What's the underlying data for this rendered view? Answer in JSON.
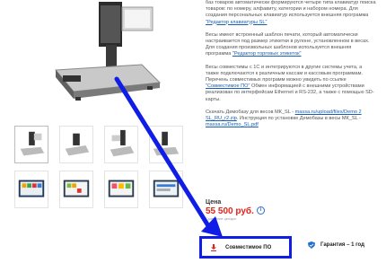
{
  "description": {
    "p1": "баз товаров автоматически формируются четыре типа клавиатур поиска товаров: по номеру, алфавиту, категории и набором номера. Для создания персональных клавиатур используется внешняя программа",
    "p1_link": "\"Редактор клавиатуры SL\"",
    "p2": "Весы имеют встроенный шаблон печати, который автоматически настраивается под размер этикетки в рулоне, установленном в весах. Для создания произвольных шаблонов используется внешняя программа",
    "p2_link": "\"Редактор торговых этикеток\"",
    "p3": "Весы совместимы с 1С и интегрируются в другие системы учета, а также подключаются к различным кассам и кассовым программам. Перечень совместимых программ можно увидеть по ссылке",
    "p3_link": "\"Совместимое ПО\"",
    "p3_tail": "Обмен информацией с внешними устройствами реализован по интерфейсам Ethernet и RS-232, а также с помощью SD-карты.",
    "p4": "Скачать Демобазу для весов МК_SL -",
    "p4_link": "massa.ru/upload/files/Demo 2 SL_RU_r2.zip",
    "p4_mid": ". Инструкция по установке Демобазы в весы МК_SL -",
    "p4_link2": "massa.ru/Demo_SL.pdf"
  },
  "price": {
    "label": "Цена",
    "value": "55 500 руб.",
    "info_glyph": "i",
    "note": "Сравнение цен/доп"
  },
  "features": {
    "compat_label": "Совместимое ПО",
    "guarantee_label": "Гарантия – 1 год"
  },
  "colors": {
    "accent_blue": "#0f1de6",
    "price_red": "#e0241b",
    "link_blue": "#1a5fb4"
  },
  "icons": {
    "compat": "download-icon",
    "guarantee": "shield-check-icon"
  }
}
